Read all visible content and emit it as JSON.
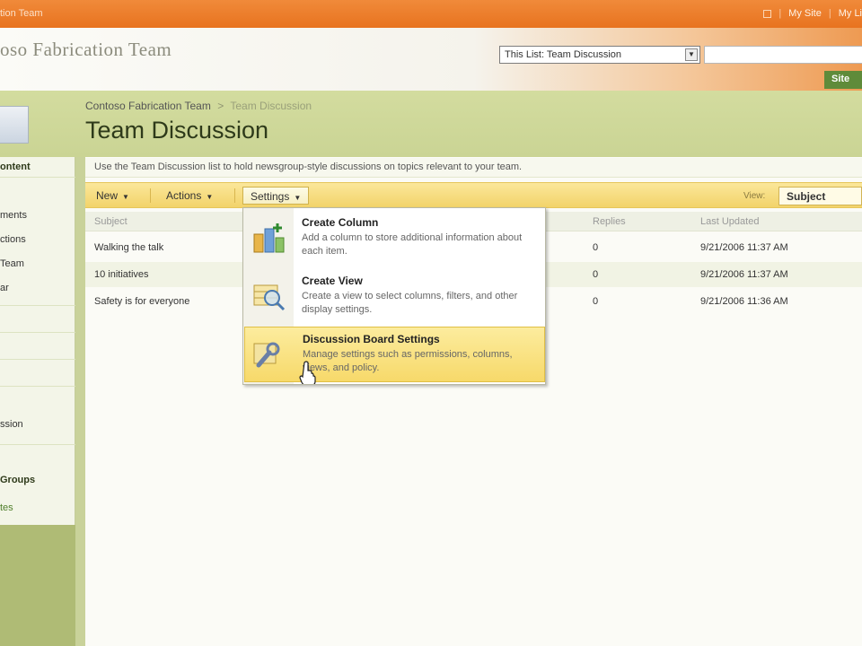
{
  "topbar": {
    "breadcrumb": "tion Team",
    "my_site": "My Site",
    "my_links": "My Li"
  },
  "header": {
    "site_title": "oso Fabrication Team",
    "scope_value": "This List: Team Discussion",
    "site_actions_label": "Site"
  },
  "titleband": {
    "breadcrumb_site": "Contoso Fabrication Team",
    "breadcrumb_sep": ">",
    "breadcrumb_current": "Team Discussion",
    "page_title": "Team Discussion"
  },
  "leftnav": {
    "items": [
      {
        "label": "ontent",
        "style": "heading"
      },
      {
        "label": "ments",
        "style": "normal"
      },
      {
        "label": "ctions",
        "style": "normal"
      },
      {
        "label": "Team",
        "style": "normal"
      },
      {
        "label": "ar",
        "style": "normal"
      },
      {
        "label": "ssion",
        "style": "normal"
      },
      {
        "label": "Groups",
        "style": "heading"
      },
      {
        "label": "tes",
        "style": "green"
      }
    ]
  },
  "list": {
    "description": "Use the Team Discussion list to hold newsgroup-style discussions on topics relevant to your team.",
    "toolbar": {
      "new_label": "New",
      "actions_label": "Actions",
      "settings_label": "Settings",
      "view_label": "View:",
      "view_value": "Subject"
    },
    "columns": {
      "subject": "Subject",
      "replies": "Replies",
      "last_updated": "Last Updated"
    },
    "rows": [
      {
        "subject": "Walking the talk",
        "replies": "0",
        "updated": "9/21/2006 11:37 AM"
      },
      {
        "subject": "10 initiatives",
        "replies": "0",
        "updated": "9/21/2006 11:37 AM"
      },
      {
        "subject": "Safety is for everyone",
        "replies": "0",
        "updated": "9/21/2006 11:36 AM"
      }
    ]
  },
  "settings_menu": {
    "items": [
      {
        "title": "Create Column",
        "desc": "Add a column to store additional information about each item.",
        "icon": "create-column-icon"
      },
      {
        "title": "Create View",
        "desc": "Create a view to select columns, filters, and other display settings.",
        "icon": "create-view-icon"
      },
      {
        "title": "Discussion Board Settings",
        "desc": "Manage settings such as permissions, columns, views, and policy.",
        "icon": "list-settings-icon"
      }
    ]
  },
  "colors": {
    "topbar_orange": "#e8731f",
    "toolbar_yellow": "#f2d36a",
    "nav_green": "#c9d29a",
    "menu_highlight": "#f7d96a"
  }
}
